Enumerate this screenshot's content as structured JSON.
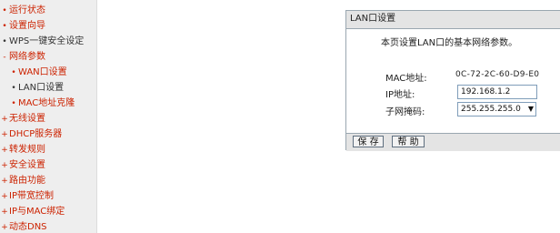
{
  "sidebar": {
    "items": [
      {
        "bullet": "•",
        "label": "运行状态",
        "color": "#cc2200",
        "sub": false
      },
      {
        "bullet": "•",
        "label": "设置向导",
        "color": "#cc2200",
        "sub": false
      },
      {
        "bullet": "•",
        "label": "WPS一键安全设定",
        "color": "#333333",
        "sub": false
      },
      {
        "bullet": "-",
        "label": "网络参数",
        "color": "#cc2200",
        "sub": false
      },
      {
        "bullet": "•",
        "label": "WAN口设置",
        "color": "#cc2200",
        "sub": true
      },
      {
        "bullet": "•",
        "label": "LAN口设置",
        "color": "#333333",
        "sub": true
      },
      {
        "bullet": "•",
        "label": "MAC地址克隆",
        "color": "#cc2200",
        "sub": true
      },
      {
        "bullet": "+",
        "label": "无线设置",
        "color": "#cc2200",
        "sub": false
      },
      {
        "bullet": "+",
        "label": "DHCP服务器",
        "color": "#cc2200",
        "sub": false
      },
      {
        "bullet": "+",
        "label": "转发规则",
        "color": "#cc2200",
        "sub": false
      },
      {
        "bullet": "+",
        "label": "安全设置",
        "color": "#cc2200",
        "sub": false
      },
      {
        "bullet": "+",
        "label": "路由功能",
        "color": "#cc2200",
        "sub": false
      },
      {
        "bullet": "+",
        "label": "IP带宽控制",
        "color": "#cc2200",
        "sub": false
      },
      {
        "bullet": "+",
        "label": "IP与MAC绑定",
        "color": "#cc2200",
        "sub": false
      },
      {
        "bullet": "+",
        "label": "动态DNS",
        "color": "#cc2200",
        "sub": false
      }
    ]
  },
  "panel": {
    "title": "LAN口设置",
    "description": "本页设置LAN口的基本网络参数。",
    "mac_label": "MAC地址:",
    "mac_value": "0C-72-2C-60-D9-E0",
    "ip_label": "IP地址:",
    "ip_value": "192.168.1.2",
    "mask_label": "子网掩码:",
    "mask_value": "255.255.255.0",
    "save_label": "保 存",
    "help_label": "帮 助"
  },
  "colors": {
    "menu_red": "#cc2200",
    "menu_gray": "#333333",
    "panel_header": "#e4e4e4"
  },
  "icons": {
    "select_arrow": "chevron-down-icon"
  }
}
